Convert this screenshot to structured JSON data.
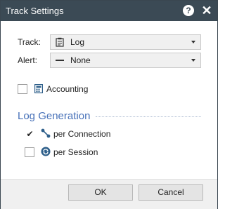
{
  "window": {
    "title": "Track Settings"
  },
  "titlebar": {
    "help_icon_glyph": "?",
    "close_icon_glyph": "✕"
  },
  "fields": {
    "track": {
      "label": "Track:",
      "value": "Log",
      "icon": "notepad-icon"
    },
    "alert": {
      "label": "Alert:",
      "value": "None",
      "icon": "dash-icon"
    }
  },
  "accounting": {
    "label": "Accounting",
    "checked": false,
    "icon": "calculator-icon"
  },
  "log_generation": {
    "title": "Log Generation",
    "options": [
      {
        "label": "per Connection",
        "checked": true,
        "icon": "connection-icon"
      },
      {
        "label": "per Session",
        "checked": false,
        "icon": "session-icon"
      }
    ]
  },
  "buttons": {
    "ok": "OK",
    "cancel": "Cancel"
  },
  "colors": {
    "titlebar": "#3b4a55",
    "section_title": "#4670b8",
    "icon_blue": "#2e5f8a"
  }
}
